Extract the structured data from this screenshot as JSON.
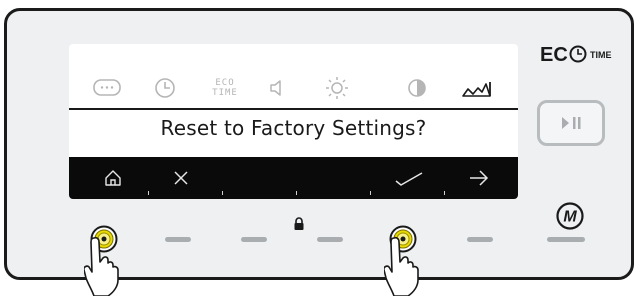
{
  "display": {
    "prompt": "Reset to Factory Settings?",
    "eco_time_label_line1": "ECO",
    "eco_time_label_line2": "TIME",
    "menu_icons": [
      "message-icon",
      "clock-icon",
      "eco-time-icon",
      "sound-icon",
      "brightness-icon",
      "contrast-icon",
      "factory-icon"
    ],
    "active_menu_icon": "factory-icon"
  },
  "softkeys": [
    "home-icon",
    "close-icon",
    "check-icon",
    "arrow-right-icon"
  ],
  "brand": {
    "eco_logo_text": "EC",
    "eco_logo_suffix": "TIME",
    "m_logo_text": "M"
  },
  "colors": {
    "panel_bg": "#eef0f2",
    "bezel": "#1b1b1b",
    "screen_bg": "#ffffff",
    "softbar_bg": "#0a0a0a",
    "inactive_icon": "#b5b5b5",
    "button_ring": "#c9b400"
  }
}
